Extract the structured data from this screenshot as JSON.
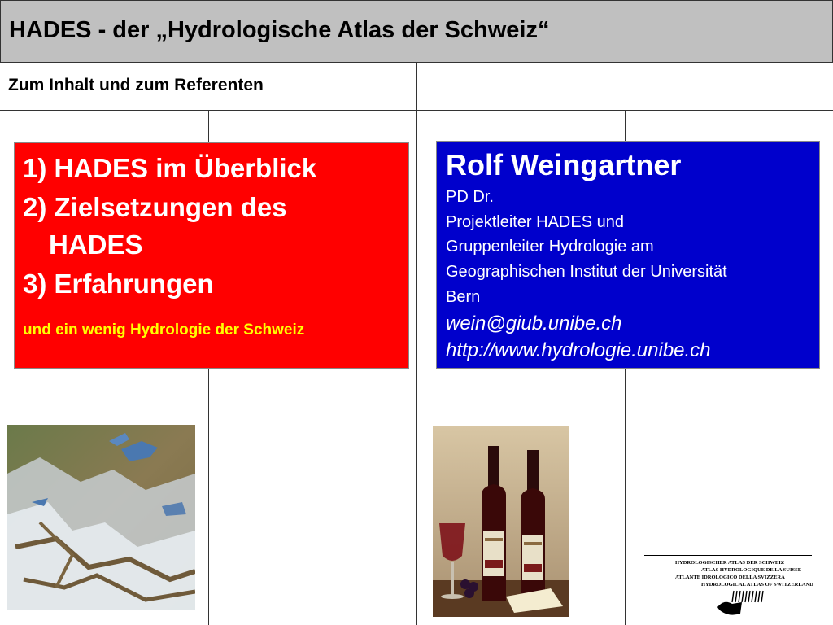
{
  "header": {
    "title": "HADES - der „Hydrologische Atlas der Schweiz“"
  },
  "subtitle": "Zum Inhalt und zum Referenten",
  "agenda": {
    "items": [
      "1) HADES im Überblick",
      "2) Zielsetzungen des",
      "HADES",
      "3) Erfahrungen"
    ],
    "note": "und ein wenig Hydrologie der Schweiz"
  },
  "speaker": {
    "name": "Rolf Weingartner",
    "lines": [
      "PD Dr.",
      "Projektleiter HADES und",
      "Gruppenleiter Hydrologie am",
      "Geographischen Institut der Universität",
      "Bern"
    ],
    "email": "wein@giub.unibe.ch",
    "url": "http://www.hydrologie.unibe.ch"
  },
  "logo": {
    "lines": [
      "HYDROLOGISCHER ATLAS DER SCHWEIZ",
      "ATLAS HYDROLOGIQUE DE LA SUISSE",
      "ATLANTE IDROLOGICO DELLA SVIZZERA",
      "HYDROLOGICAL ATLAS OF SWITZERLAND"
    ]
  },
  "colors": {
    "header_bg": "#c0c0c0",
    "agenda_bg": "#ff0000",
    "agenda_note": "#ffff00",
    "speaker_bg": "#0000cc"
  },
  "images": {
    "map": "satellite-map-switzerland",
    "wine": "wine-bottles-photo"
  }
}
